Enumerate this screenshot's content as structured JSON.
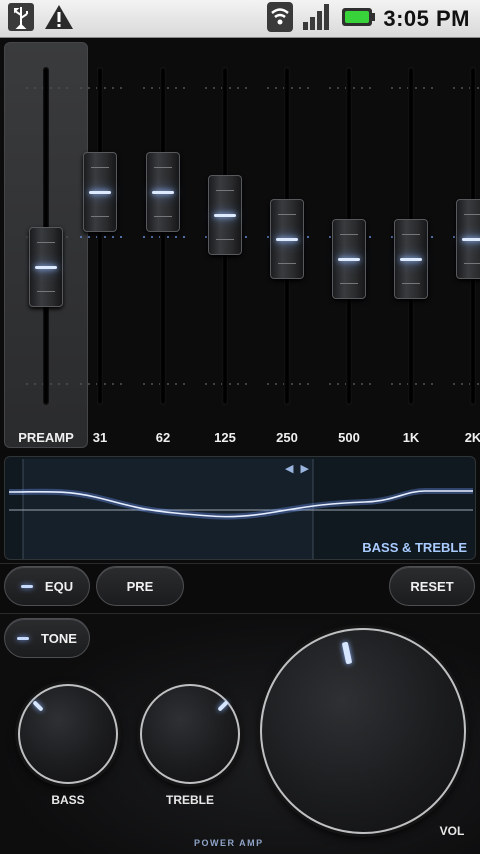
{
  "status_bar": {
    "left_icons": [
      "usb-icon",
      "warning-icon"
    ],
    "right_icons": [
      "wifi-icon",
      "signal-icon",
      "battery-icon"
    ],
    "time": "3:05 PM"
  },
  "equalizer": {
    "preamp": {
      "label": "PREAMP",
      "level": 0.38
    },
    "bands": [
      {
        "label": "31",
        "level": 0.67
      },
      {
        "label": "62",
        "level": 0.67
      },
      {
        "label": "125",
        "level": 0.58
      },
      {
        "label": "250",
        "level": 0.49
      },
      {
        "label": "500",
        "level": 0.41
      },
      {
        "label": "1K",
        "level": 0.41
      },
      {
        "label": "2K",
        "level": 0.49
      }
    ]
  },
  "graph": {
    "title": "BASS & TREBLE",
    "arrows": "◀ ▶"
  },
  "buttons": {
    "equ": "EQU",
    "pre": "PRE",
    "reset": "RESET",
    "tone": "TONE"
  },
  "knobs": {
    "bass": {
      "label": "BASS"
    },
    "treble": {
      "label": "TREBLE"
    },
    "volume": {
      "label": "VOL"
    }
  },
  "brand": "POWER AMP",
  "colors": {
    "accent": "#a9cbff",
    "led": "#ddeaff"
  }
}
